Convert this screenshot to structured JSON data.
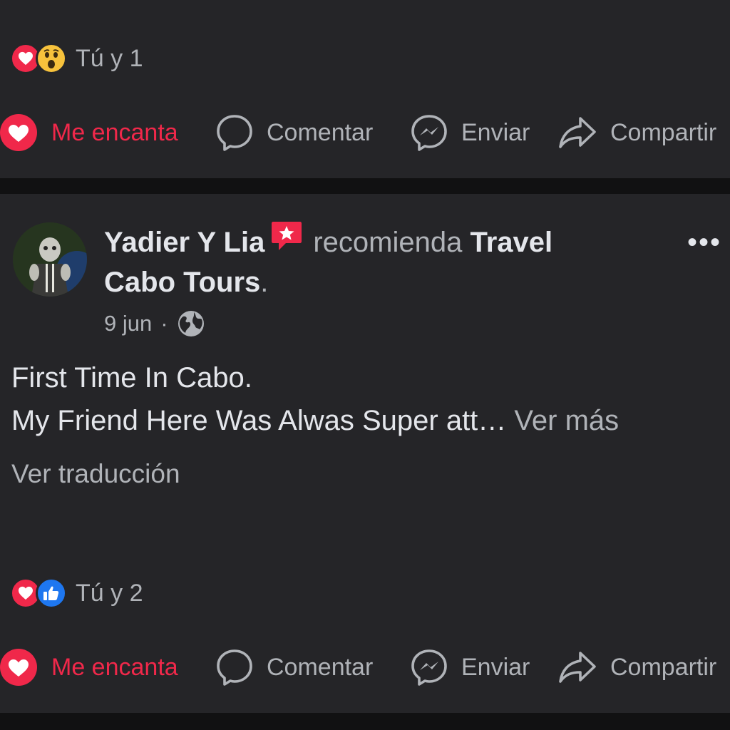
{
  "post_top": {
    "reactions": [
      "love",
      "wow"
    ],
    "reaction_count": "Tú y 1",
    "actions": {
      "love_label": "Me encanta",
      "comment_label": "Comentar",
      "send_label": "Enviar",
      "share_label": "Compartir"
    }
  },
  "post_main": {
    "author": "Yadier Y Lia",
    "verb": "recomienda",
    "page_name_1": "Travel",
    "page_name_2": "Cabo Tours",
    "page_suffix": ".",
    "date": "9 jun",
    "date_separator": "·",
    "audience_icon": "globe-icon",
    "more_label": "•••",
    "body_line1": "First Time In Cabo.",
    "body_line2": "My Friend Here Was Alwas Super att…",
    "see_more": "Ver más",
    "translate": "Ver traducción",
    "reactions": [
      "love",
      "like"
    ],
    "reaction_count": "Tú y 2",
    "actions": {
      "love_label": "Me encanta",
      "comment_label": "Comentar",
      "send_label": "Enviar",
      "share_label": "Compartir"
    }
  },
  "colors": {
    "background": "#252528",
    "separator": "#111112",
    "love": "#f0284a",
    "like": "#1e77f0",
    "wow": "#f7c23c",
    "text_primary": "#e4e6eb",
    "text_secondary": "#b0b3b8"
  }
}
